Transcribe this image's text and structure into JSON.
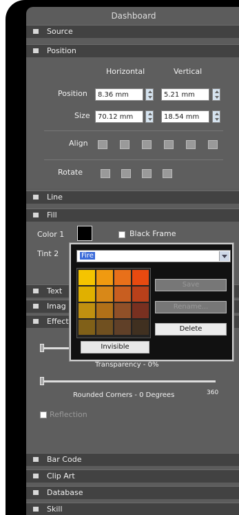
{
  "panel": {
    "title": "Dashboard"
  },
  "sections": {
    "source": "Source",
    "position": "Position",
    "line": "Line",
    "fill": "Fill",
    "text": "Text",
    "image": "Imag",
    "effects": "Effect",
    "barcode": "Bar Code",
    "clipart": "Clip Art",
    "database": "Database",
    "last": "Skill"
  },
  "position": {
    "col_horizontal": "Horizontal",
    "col_vertical": "Vertical",
    "row_position": "Position",
    "row_size": "Size",
    "pos_h": "8.36 mm",
    "pos_v": "5.21 mm",
    "size_h": "70.12 mm",
    "size_v": "18.54 mm",
    "align_label": "Align",
    "flip_label": "Rotate"
  },
  "fill": {
    "color1_label": "Color 1",
    "color2_label": "Tint 2",
    "black_bg_label": "Black Frame"
  },
  "popup": {
    "combo_value": "Fire",
    "save": "Save",
    "rename": "Rename...",
    "delete": "Delete",
    "invisible": "Invisible",
    "swatches": [
      "#f5c400",
      "#f09a10",
      "#e8701a",
      "#e84a10",
      "#e0b000",
      "#d88818",
      "#c85e20",
      "#b8401a",
      "#c09010",
      "#b07018",
      "#905028",
      "#783020",
      "#806018",
      "#705020",
      "#604028",
      "#403020"
    ]
  },
  "effects": {
    "transparency_label": "Transparency - 0%",
    "rounded_label": "Rounded Corners - 0 Degrees",
    "rounded_max": "360",
    "reflection_label": "Reflection"
  }
}
